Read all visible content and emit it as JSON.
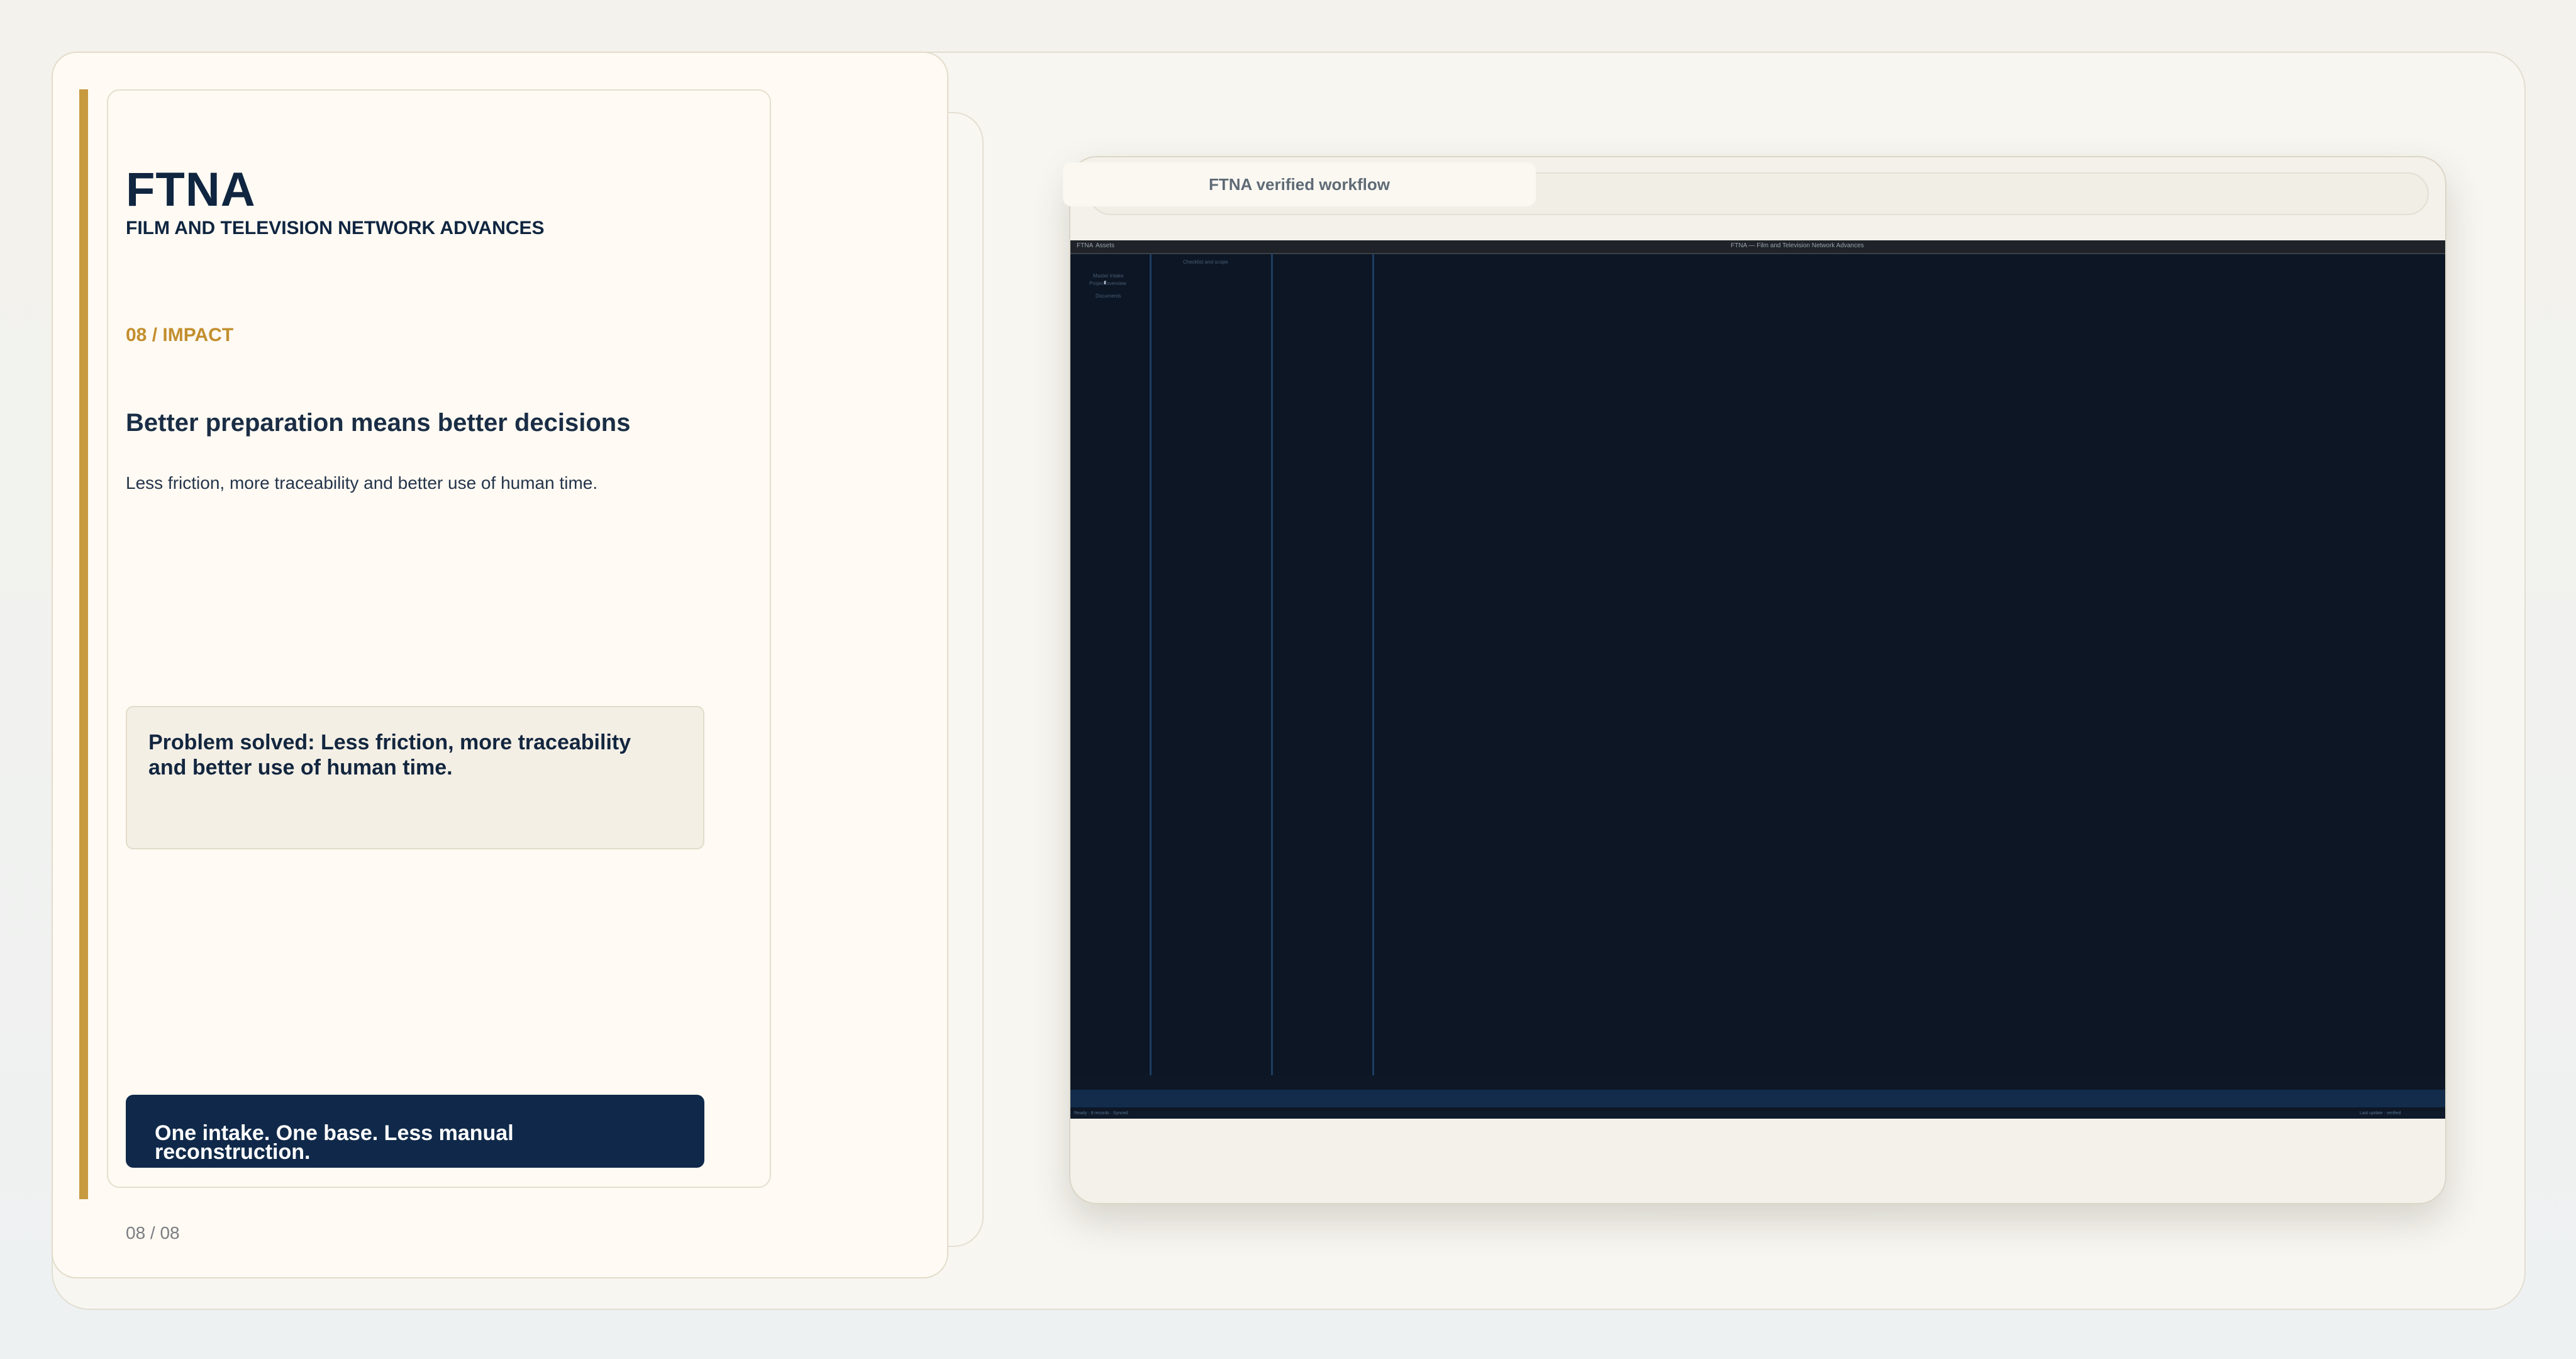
{
  "slide": {
    "logo": "FTNA",
    "subtitle": "FILM AND TELEVISION NETWORK ADVANCES",
    "section": "08 / IMPACT",
    "headline": "Better preparation means better decisions",
    "body": "Less friction, more traceability and better use of human time.",
    "problem": "Problem solved: Less friction, more traceability and better use of human time.",
    "cta": "One intake. One base. Less manual reconstruction.",
    "page_number": "08 / 08"
  },
  "device": {
    "badge": "FTNA verified workflow",
    "screen": {
      "topbar_left_1": "FTNA",
      "topbar_left_2": "Assets",
      "topbar_center": "FTNA — Film and Television Network Advances",
      "sidebar_title": "Master Intake",
      "sidebar_sub": "Project overview",
      "sidebar_extra": "Documents",
      "column_header": "Checklist and scope",
      "status_left": "Ready · 8 records · Synced",
      "status_right": "Last update · verified"
    }
  },
  "colors": {
    "accent": "#c79a40",
    "navy": "#10294a",
    "screen_bg": "#0d1726"
  }
}
